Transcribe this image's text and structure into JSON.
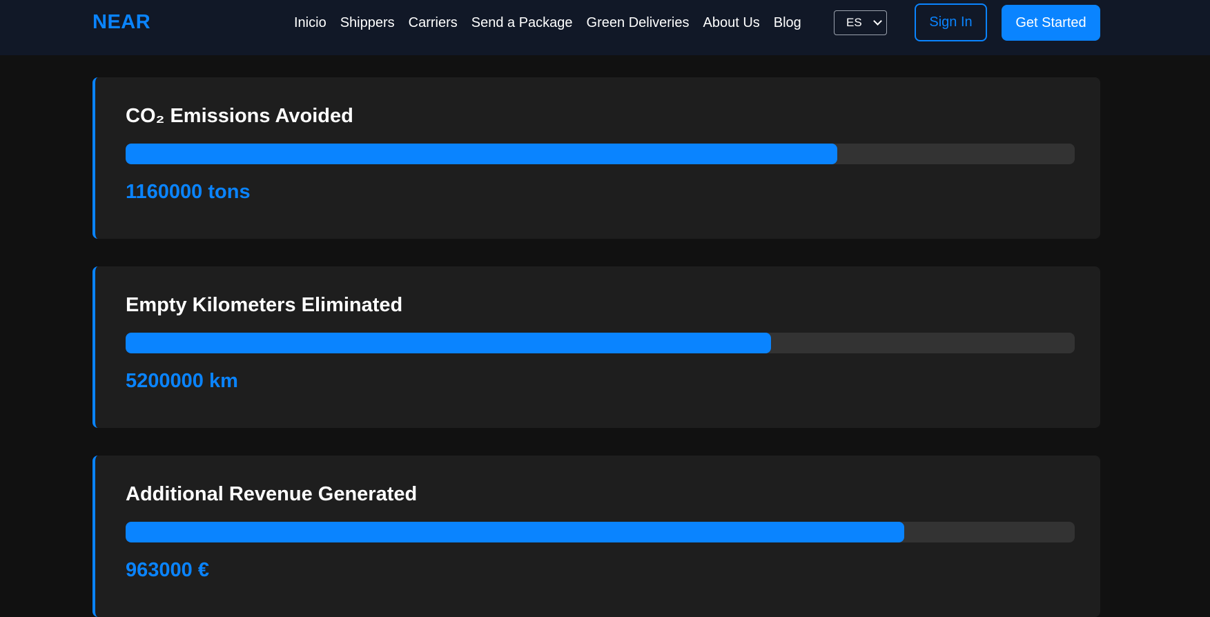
{
  "header": {
    "logo": "NEAR",
    "nav": [
      "Inicio",
      "Shippers",
      "Carriers",
      "Send a Package",
      "Green Deliveries",
      "About Us",
      "Blog"
    ],
    "language": "ES",
    "sign_in": "Sign In",
    "get_started": "Get Started"
  },
  "metrics": [
    {
      "title": "CO₂ Emissions Avoided",
      "value": "1160000 tons",
      "progress": 0.75
    },
    {
      "title": "Empty Kilometers Eliminated",
      "value": "5200000 km",
      "progress": 0.68
    },
    {
      "title": "Additional Revenue Generated",
      "value": "963000 €",
      "progress": 0.82
    }
  ],
  "colors": {
    "accent": "#0a84ff",
    "page_background": "#111111",
    "header_background": "#111827",
    "card_background": "#1e1e1e",
    "track": "#333333"
  }
}
